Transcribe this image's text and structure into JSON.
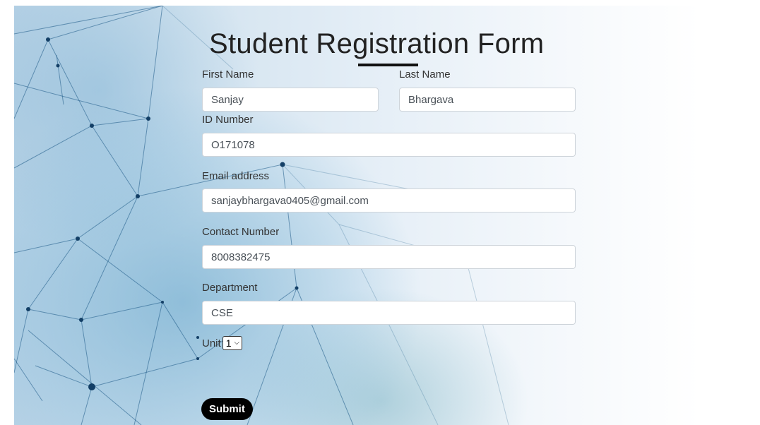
{
  "title": "Student Registration Form",
  "fields": {
    "first_name": {
      "label": "First Name",
      "value": "Sanjay"
    },
    "last_name": {
      "label": "Last Name",
      "value": "Bhargava"
    },
    "id_number": {
      "label": "ID Number",
      "value": "O171078"
    },
    "email": {
      "label": "Email address",
      "value": "sanjaybhargava0405@gmail.com"
    },
    "contact": {
      "label": "Contact Number",
      "value": "8008382475"
    },
    "department": {
      "label": "Department",
      "value": "CSE"
    }
  },
  "unit": {
    "label": "Unit",
    "selected": "1"
  },
  "submit_label": "Submit"
}
